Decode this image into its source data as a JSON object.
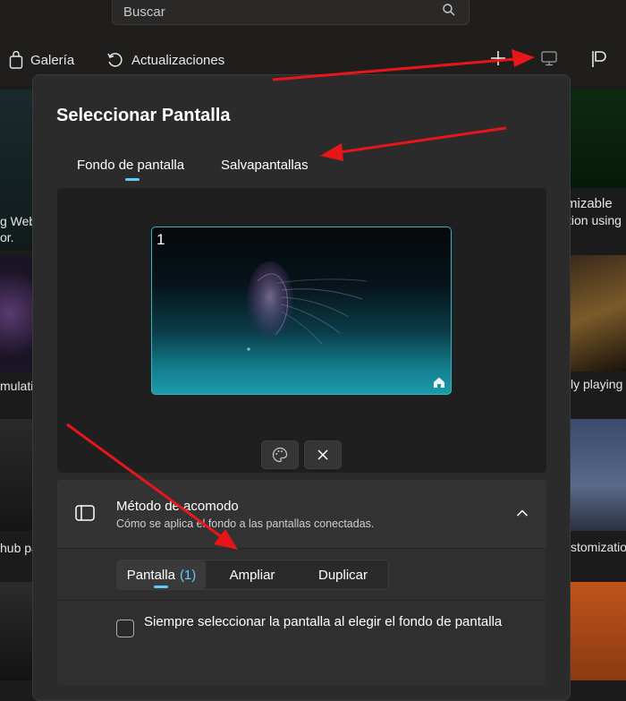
{
  "search": {
    "placeholder": "Buscar"
  },
  "nav": {
    "gallery": "Galería",
    "updates": "Actualizaciones"
  },
  "background_tiles": {
    "left_1": "g Web",
    "left_2": "or.",
    "left_3": "mulatio",
    "left_4": "hub pa",
    "right_1": "mizable",
    "right_2": "tion using",
    "right_3": "ly playing",
    "right_4": "stomizatio"
  },
  "dialog": {
    "title": "Seleccionar Pantalla",
    "tabs": [
      "Fondo de pantalla",
      "Salvapantallas"
    ],
    "monitor_number": "1",
    "fit_method": {
      "title": "Método de acomodo",
      "subtitle": "Cómo se aplica el fondo a las pantallas conectadas.",
      "options": {
        "screen": "Pantalla",
        "screen_count": "(1)",
        "extend": "Ampliar",
        "duplicate": "Duplicar"
      }
    },
    "checkbox_label": "Siempre seleccionar la pantalla al elegir el fondo de pantalla"
  },
  "colors": {
    "accent": "#60cdff",
    "annotation_arrow": "#e8161b"
  }
}
